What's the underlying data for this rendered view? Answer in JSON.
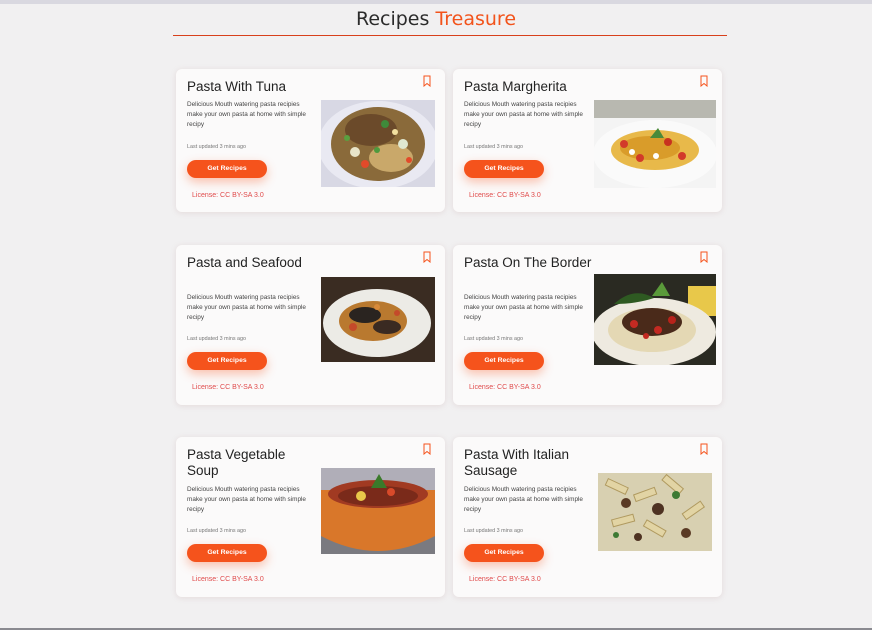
{
  "header": {
    "title_main": "Recipes",
    "title_accent": "Treasure"
  },
  "colors": {
    "accent": "#f5531c",
    "license": "#e04a4a",
    "background": "#f1f0f1",
    "card": "#fbfafa"
  },
  "card_common": {
    "description": "Delicious Mouth watering pasta recipies make your own pasta at home with simple recipy",
    "updated": "Last updated 3 mins ago",
    "button_label": "Get Recipes",
    "license": "License: CC BY-SA 3.0",
    "bookmark_icon": "bookmark-icon"
  },
  "recipes": [
    {
      "title": "Pasta With Tuna"
    },
    {
      "title": "Pasta Margherita"
    },
    {
      "title": "Pasta and Seafood"
    },
    {
      "title": "Pasta On The Border"
    },
    {
      "title": "Pasta Vegetable Soup"
    },
    {
      "title": "Pasta With Italian Sausage"
    }
  ]
}
